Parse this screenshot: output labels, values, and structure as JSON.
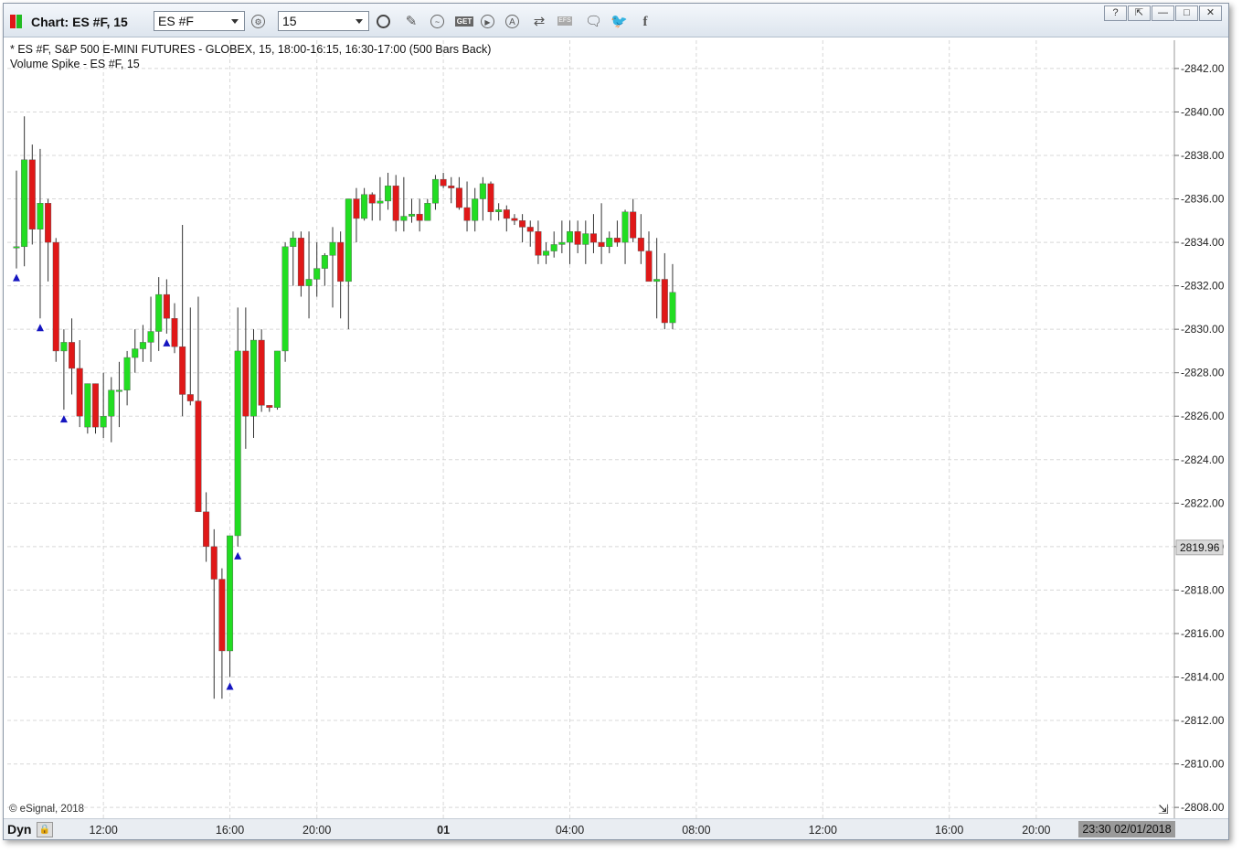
{
  "window": {
    "title": "Chart: ES #F, 15",
    "symbol": "ES #F",
    "interval": "15",
    "window_buttons": [
      "?",
      "⇱",
      "—",
      "□",
      "✕"
    ]
  },
  "toolbar_icons": [
    "interval-clock-icon",
    "draw-pencil-icon",
    "indicator-icon",
    "get-icon",
    "replay-icon",
    "alert-icon",
    "sync-icon",
    "efs-icon",
    "comment-icon",
    "twitter-icon",
    "facebook-icon"
  ],
  "toolbar_labels": {
    "get": "GET",
    "efs": "EFS"
  },
  "legend": {
    "line1": "* ES #F, S&P 500 E-MINI FUTURES - GLOBEX, 15, 18:00-16:15, 16:30-17:00 (500 Bars Back)",
    "line2": "Volume Spike - ES #F, 15"
  },
  "copyright": "© eSignal, 2018",
  "bottom": {
    "dyn_label": "Dyn",
    "cursor_time": "23:30 02/01/2018"
  },
  "colors": {
    "up": "#22dd22",
    "down": "#e01818",
    "marker": "#1515c0",
    "grid": "#d8d8d8",
    "wick": "#333333"
  },
  "chart_data": {
    "type": "candlestick",
    "ylim": [
      2807.5,
      2843.3
    ],
    "y_ticks": [
      "2808.00",
      "2810.00",
      "2812.00",
      "2814.00",
      "2816.00",
      "2818.00",
      "2820.00",
      "2822.00",
      "2824.00",
      "2826.00",
      "2828.00",
      "2830.00",
      "2832.00",
      "2834.00",
      "2836.00",
      "2838.00",
      "2840.00",
      "2842.00"
    ],
    "x_ticks": [
      {
        "label": "12:00",
        "bar": 11
      },
      {
        "label": "16:00",
        "bar": 27
      },
      {
        "label": "20:00",
        "bar": 38
      },
      {
        "label": "01",
        "bar": 54,
        "bold": true
      },
      {
        "label": "04:00",
        "bar": 70
      },
      {
        "label": "08:00",
        "bar": 86
      },
      {
        "label": "12:00",
        "bar": 102
      },
      {
        "label": "16:00",
        "bar": 118
      },
      {
        "label": "20:00",
        "bar": 129
      }
    ],
    "last_price": "2819.96",
    "last_price_value": 2819.96,
    "bars": [
      [
        2833.8,
        2837.3,
        2832.8,
        2833.8
      ],
      [
        2833.8,
        2839.8,
        2832.9,
        2837.8
      ],
      [
        2837.8,
        2838.5,
        2833.9,
        2834.6
      ],
      [
        2834.6,
        2838.3,
        2830.5,
        2835.8
      ],
      [
        2835.8,
        2836.0,
        2832.2,
        2834.0
      ],
      [
        2834.0,
        2834.2,
        2828.5,
        2829.0
      ],
      [
        2829.0,
        2830.0,
        2826.3,
        2829.4
      ],
      [
        2829.4,
        2830.5,
        2827.0,
        2828.2
      ],
      [
        2828.2,
        2829.5,
        2825.5,
        2826.0
      ],
      [
        2825.5,
        2827.5,
        2825.2,
        2827.5
      ],
      [
        2827.5,
        2827.5,
        2825.2,
        2825.5
      ],
      [
        2825.5,
        2828.0,
        2825.0,
        2826.0
      ],
      [
        2826.0,
        2827.8,
        2824.8,
        2827.2
      ],
      [
        2827.2,
        2828.5,
        2825.5,
        2827.2
      ],
      [
        2827.2,
        2829.0,
        2826.5,
        2828.7
      ],
      [
        2828.7,
        2830.0,
        2828.0,
        2829.1
      ],
      [
        2829.1,
        2830.2,
        2828.5,
        2829.4
      ],
      [
        2829.4,
        2831.5,
        2828.5,
        2829.9
      ],
      [
        2829.9,
        2832.4,
        2829.0,
        2831.6
      ],
      [
        2831.6,
        2832.3,
        2829.8,
        2830.5
      ],
      [
        2830.5,
        2831.2,
        2828.9,
        2829.2
      ],
      [
        2829.2,
        2834.8,
        2826.0,
        2827.0
      ],
      [
        2827.0,
        2831.0,
        2826.5,
        2826.7
      ],
      [
        2826.7,
        2831.5,
        2822.0,
        2821.6
      ],
      [
        2821.6,
        2822.5,
        2819.3,
        2820.0
      ],
      [
        2820.0,
        2820.8,
        2813.0,
        2818.5
      ],
      [
        2818.5,
        2819.0,
        2813.0,
        2815.2
      ],
      [
        2815.2,
        2820.0,
        2814.0,
        2820.5
      ],
      [
        2820.5,
        2831.0,
        2820.0,
        2829.0
      ],
      [
        2829.0,
        2831.0,
        2824.5,
        2826.0
      ],
      [
        2826.0,
        2830.0,
        2825.0,
        2829.5
      ],
      [
        2829.5,
        2830.0,
        2826.2,
        2826.5
      ],
      [
        2826.5,
        2826.5,
        2826.2,
        2826.4
      ],
      [
        2826.4,
        2829.0,
        2826.3,
        2829.0
      ],
      [
        2829.0,
        2834.0,
        2828.5,
        2833.8
      ],
      [
        2833.8,
        2834.5,
        2832.0,
        2834.2
      ],
      [
        2834.2,
        2834.5,
        2831.5,
        2832.0
      ],
      [
        2832.0,
        2834.5,
        2830.5,
        2832.3
      ],
      [
        2832.3,
        2834.0,
        2831.5,
        2832.8
      ],
      [
        2832.8,
        2833.5,
        2832.0,
        2833.4
      ],
      [
        2833.4,
        2834.7,
        2831.0,
        2834.0
      ],
      [
        2834.0,
        2834.5,
        2830.5,
        2832.2
      ],
      [
        2832.2,
        2836.0,
        2830.0,
        2836.0
      ],
      [
        2836.0,
        2836.5,
        2834.0,
        2835.1
      ],
      [
        2835.1,
        2836.5,
        2835.0,
        2836.2
      ],
      [
        2836.2,
        2836.3,
        2835.0,
        2835.8
      ],
      [
        2835.8,
        2837.0,
        2835.0,
        2835.9
      ],
      [
        2835.9,
        2837.2,
        2835.5,
        2836.6
      ],
      [
        2836.6,
        2837.1,
        2834.5,
        2835.0
      ],
      [
        2835.0,
        2837.0,
        2834.5,
        2835.2
      ],
      [
        2835.2,
        2836.0,
        2834.9,
        2835.3
      ],
      [
        2835.3,
        2836.0,
        2834.5,
        2835.0
      ],
      [
        2835.0,
        2836.0,
        2835.0,
        2835.8
      ],
      [
        2835.8,
        2837.1,
        2835.5,
        2836.9
      ],
      [
        2836.9,
        2837.2,
        2836.5,
        2836.6
      ],
      [
        2836.6,
        2837.0,
        2835.8,
        2836.5
      ],
      [
        2836.5,
        2837.0,
        2835.5,
        2835.6
      ],
      [
        2835.6,
        2836.8,
        2834.5,
        2835.0
      ],
      [
        2835.0,
        2836.5,
        2834.5,
        2836.0
      ],
      [
        2836.0,
        2837.0,
        2835.0,
        2836.7
      ],
      [
        2836.7,
        2836.8,
        2835.0,
        2835.4
      ],
      [
        2835.4,
        2835.8,
        2835.0,
        2835.5
      ],
      [
        2835.5,
        2835.7,
        2834.5,
        2835.1
      ],
      [
        2835.1,
        2835.3,
        2834.8,
        2835.0
      ],
      [
        2835.0,
        2835.3,
        2834.0,
        2834.7
      ],
      [
        2834.7,
        2835.0,
        2833.8,
        2834.5
      ],
      [
        2834.5,
        2835.0,
        2833.0,
        2833.4
      ],
      [
        2833.4,
        2834.0,
        2833.0,
        2833.6
      ],
      [
        2833.6,
        2834.5,
        2833.3,
        2833.9
      ],
      [
        2833.9,
        2835.0,
        2833.5,
        2834.0
      ],
      [
        2834.0,
        2835.0,
        2833.0,
        2834.5
      ],
      [
        2834.5,
        2835.0,
        2833.5,
        2833.9
      ],
      [
        2833.9,
        2835.0,
        2833.0,
        2834.4
      ],
      [
        2834.4,
        2835.3,
        2833.5,
        2834.0
      ],
      [
        2834.0,
        2835.8,
        2833.0,
        2833.8
      ],
      [
        2833.8,
        2834.5,
        2833.5,
        2834.2
      ],
      [
        2834.2,
        2835.0,
        2833.8,
        2834.0
      ],
      [
        2834.0,
        2835.5,
        2833.0,
        2835.4
      ],
      [
        2835.4,
        2836.0,
        2834.0,
        2834.2
      ],
      [
        2834.2,
        2835.3,
        2833.0,
        2833.6
      ],
      [
        2833.6,
        2834.5,
        2832.5,
        2832.2
      ],
      [
        2832.2,
        2834.2,
        2830.5,
        2832.3
      ],
      [
        2832.3,
        2833.5,
        2830.0,
        2830.3
      ],
      [
        2830.3,
        2833.0,
        2830.0,
        2831.7
      ]
    ],
    "markers": [
      {
        "bar": 0
      },
      {
        "bar": 3
      },
      {
        "bar": 6
      },
      {
        "bar": 19
      },
      {
        "bar": 27
      },
      {
        "bar": 28
      }
    ]
  }
}
